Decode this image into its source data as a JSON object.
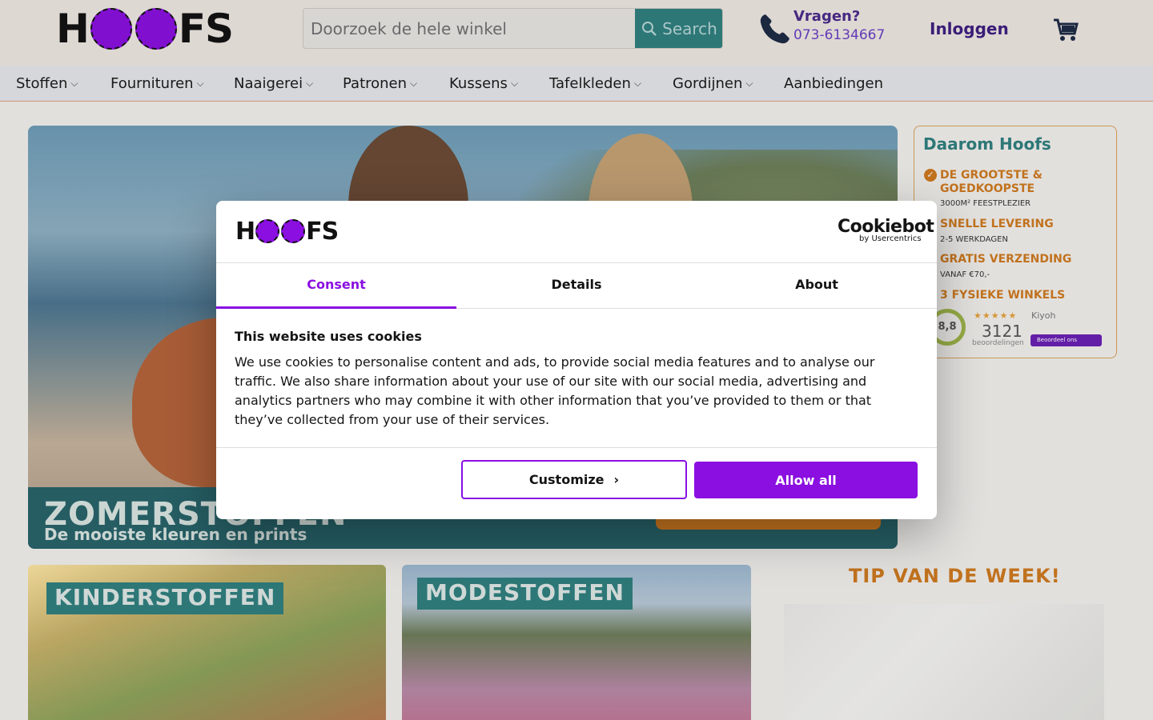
{
  "header": {
    "logo_text": "HOOFS",
    "search": {
      "placeholder": "Doorzoek de hele winkel",
      "button_label": "Search"
    },
    "contact": {
      "label": "Vragen?",
      "phone": "073-6134667"
    },
    "login_label": "Inloggen"
  },
  "nav": {
    "items": [
      {
        "label": "Stoffen",
        "has_dropdown": true
      },
      {
        "label": "Fournituren",
        "has_dropdown": true
      },
      {
        "label": "Naaigerei",
        "has_dropdown": true
      },
      {
        "label": "Patronen",
        "has_dropdown": true
      },
      {
        "label": "Kussens",
        "has_dropdown": true
      },
      {
        "label": "Tafelkleden",
        "has_dropdown": true
      },
      {
        "label": "Gordijnen",
        "has_dropdown": true
      },
      {
        "label": "Aanbiedingen",
        "has_dropdown": false
      }
    ]
  },
  "hero": {
    "title": "ZOMERSTOFFEN",
    "subtitle": "De mooiste kleuren en prints"
  },
  "why": {
    "title": "Daarom Hoofs",
    "items": [
      {
        "title": "DE GROOTSTE &",
        "title2": "GOEDKOOPSTE",
        "sub": "3000M² FEESTPLEZIER"
      },
      {
        "title": "SNELLE LEVERING",
        "sub": "2-5 WERKDAGEN"
      },
      {
        "title": "GRATIS VERZENDING",
        "sub": "VANAF €70,-"
      },
      {
        "title": "3 FYSIEKE WINKELS"
      }
    ],
    "kiyoh": {
      "score": "8,8",
      "name": "Kiyoh",
      "count": "3121",
      "label": "beoordelingen",
      "button": "Beoordeel ons"
    }
  },
  "tiles": [
    {
      "label": "KINDERSTOFFEN"
    },
    {
      "label": "MODESTOFFEN"
    }
  ],
  "tip": {
    "title": "TIP VAN DE WEEK!"
  },
  "cookie_dialog": {
    "logo_text": "HOOFS",
    "provider": "Cookiebot",
    "provider_sub": "by Usercentrics",
    "tabs": [
      "Consent",
      "Details",
      "About"
    ],
    "active_tab": "Consent",
    "title": "This website uses cookies",
    "body": "We use cookies to personalise content and ads, to provide social media features and to analyse our traffic. We also share information about your use of our site with our social media, advertising and analytics partners who may combine it with other information that you’ve provided to them or that they’ve collected from your use of their services.",
    "customize_label": "Customize",
    "allow_label": "Allow all"
  },
  "colors": {
    "brand_purple": "#8a0fe0",
    "teal": "#2f7f7f",
    "orange": "#d07a1f"
  }
}
